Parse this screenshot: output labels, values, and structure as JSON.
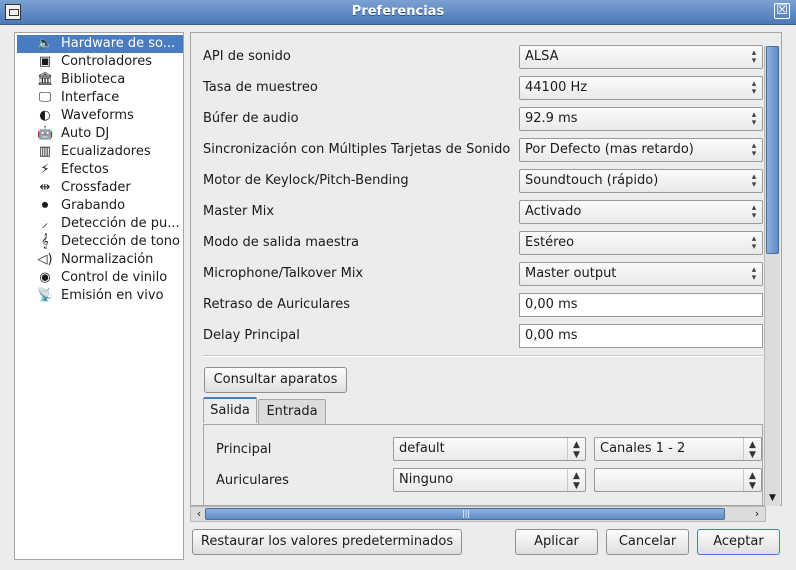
{
  "window": {
    "title": "Preferencias",
    "close_glyph": "☒"
  },
  "sidebar": {
    "items": [
      {
        "label": "Hardware de so...",
        "icon": "speaker-icon",
        "glyph": "🔈",
        "selected": true
      },
      {
        "label": "Controladores",
        "icon": "controller-icon",
        "glyph": "▣"
      },
      {
        "label": "Biblioteca",
        "icon": "library-icon",
        "glyph": "🏛"
      },
      {
        "label": "Interface",
        "icon": "monitor-icon",
        "glyph": "🖵"
      },
      {
        "label": "Waveforms",
        "icon": "waveforms-icon",
        "glyph": "◐"
      },
      {
        "label": "Auto DJ",
        "icon": "robot-icon",
        "glyph": "🤖"
      },
      {
        "label": "Ecualizadores",
        "icon": "equalizer-icon",
        "glyph": "▥"
      },
      {
        "label": "Efectos",
        "icon": "effects-icon",
        "glyph": "⚡"
      },
      {
        "label": "Crossfader",
        "icon": "crossfader-icon",
        "glyph": "⇹"
      },
      {
        "label": "Grabando",
        "icon": "recording-icon",
        "glyph": "⏺"
      },
      {
        "label": "Detección de pu...",
        "icon": "beat-detection-icon",
        "glyph": "⸝"
      },
      {
        "label": "Detección de tono",
        "icon": "key-detection-icon",
        "glyph": "𝄞"
      },
      {
        "label": "Normalización",
        "icon": "normalization-icon",
        "glyph": "◁)"
      },
      {
        "label": "Control de vinilo",
        "icon": "vinyl-icon",
        "glyph": "◉"
      },
      {
        "label": "Emisión en vivo",
        "icon": "broadcast-icon",
        "glyph": "📡"
      }
    ]
  },
  "settings": {
    "rows": [
      {
        "label": "API de sonido",
        "value": "ALSA",
        "kind": "combo"
      },
      {
        "label": "Tasa de muestreo",
        "value": "44100 Hz",
        "kind": "combo"
      },
      {
        "label": "Búfer de audio",
        "value": "92.9 ms",
        "kind": "combo"
      },
      {
        "label": "Sincronización con Múltiples Tarjetas de Sonido",
        "value": "Por Defecto (mas retardo)",
        "kind": "combo"
      },
      {
        "label": "Motor de Keylock/Pitch-Bending",
        "value": "Soundtouch (rápido)",
        "kind": "combo"
      },
      {
        "label": "Master Mix",
        "value": "Activado",
        "kind": "combo"
      },
      {
        "label": "Modo de salida maestra",
        "value": "Estéreo",
        "kind": "combo"
      },
      {
        "label": "Microphone/Talkover Mix",
        "value": "Master output",
        "kind": "combo"
      },
      {
        "label": "Retraso de Auriculares",
        "value": "0,00 ms",
        "kind": "spin"
      },
      {
        "label": "Delay Principal",
        "value": "0,00 ms",
        "kind": "spin"
      }
    ],
    "query_devices_label": "Consultar aparatos"
  },
  "tabs": {
    "items": [
      "Salida",
      "Entrada"
    ],
    "active": "Salida",
    "outputs": [
      {
        "label": "Principal",
        "device": "default",
        "channels": "Canales 1 - 2"
      },
      {
        "label": "Auriculares",
        "device": "Ninguno",
        "channels": ""
      }
    ]
  },
  "footer": {
    "restore_label": "Restaurar los valores predeterminados",
    "apply_label": "Aplicar",
    "cancel_label": "Cancelar",
    "accept_label": "Aceptar"
  }
}
